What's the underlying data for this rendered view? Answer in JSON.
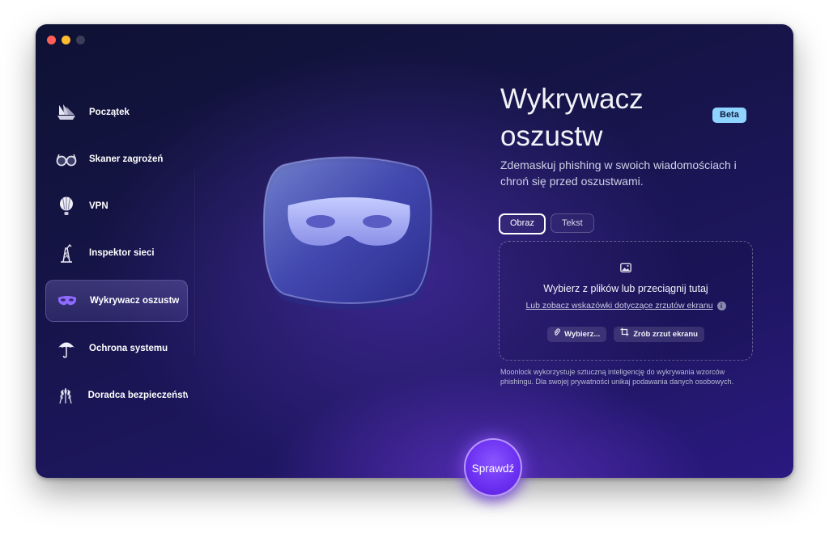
{
  "window": {
    "traffic_lights": [
      "close",
      "minimize",
      "zoom"
    ]
  },
  "sidebar": {
    "items": [
      {
        "label": "Początek",
        "icon": "home-sailboat-icon",
        "active": false
      },
      {
        "label": "Skaner zagrożeń",
        "icon": "glasses-scanner-icon",
        "active": false
      },
      {
        "label": "VPN",
        "icon": "balloon-icon",
        "active": false
      },
      {
        "label": "Inspektor sieci",
        "icon": "network-tower-icon",
        "active": false
      },
      {
        "label": "Wykrywacz oszustw",
        "icon": "mask-icon",
        "active": true
      },
      {
        "label": "Ochrona systemu",
        "icon": "umbrella-icon",
        "active": false
      },
      {
        "label": "Doradca bezpieczeństw",
        "icon": "wheat-icon",
        "active": false
      }
    ]
  },
  "main": {
    "title": "Wykrywacz oszustw",
    "badge": "Beta",
    "subtitle": "Zdemaskuj phishing w swoich wiadomościach i chroń się przed oszustwami.",
    "tabs": [
      {
        "label": "Obraz",
        "active": true
      },
      {
        "label": "Tekst",
        "active": false
      }
    ],
    "dropzone": {
      "icon": "image-icon",
      "main_text": "Wybierz z plików lub przeciągnij tutaj",
      "link_text": "Lub zobacz wskazówki dotyczące zrzutów ekranu",
      "info": "i",
      "choose_button": "Wybierz...",
      "screenshot_button": "Zrób zrzut ekranu"
    },
    "disclaimer": "Moonlock wykorzystuje sztuczną inteligencję do wykrywania wzorców phishingu. Dla swojej prywatności unikaj podawania danych osobowych.",
    "check_button": "Sprawdź"
  },
  "colors": {
    "accent": "#6a2ff0",
    "badge": "#8fd3ff",
    "active_item_icon": "#8f6bff"
  }
}
